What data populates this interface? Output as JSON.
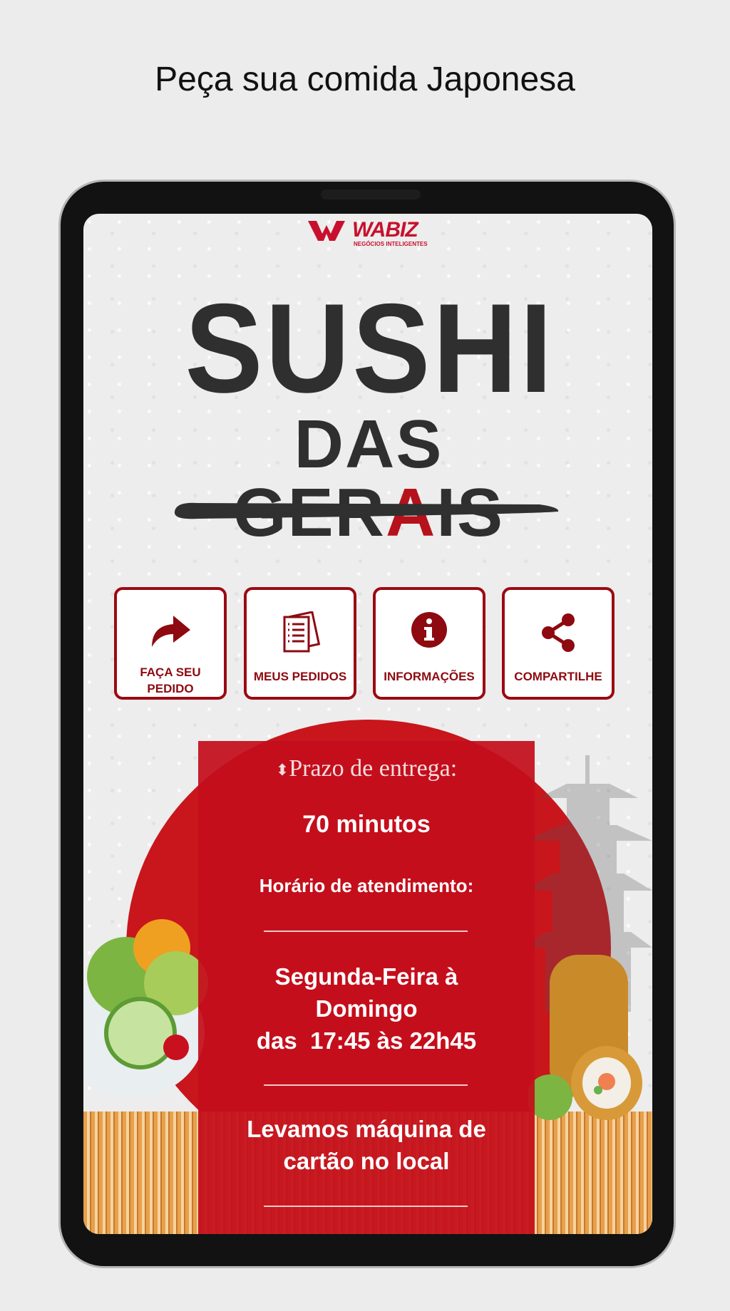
{
  "headline": "Peça sua comida Japonesa",
  "brand": {
    "name": "WABIZ",
    "tagline": "NEGÓCIOS INTELIGENTES"
  },
  "logo": {
    "line1": "SUSHI",
    "line2_part1": "DAS GER",
    "line2_red": "A",
    "line2_part2": "IS"
  },
  "buttons": [
    {
      "label_line1": "FAÇA SEU",
      "label_line2": "PEDIDO",
      "icon": "share-arrow-icon"
    },
    {
      "label": "MEUS PEDIDOS",
      "icon": "receipt-icon"
    },
    {
      "label": "INFORMAÇÕES",
      "icon": "info-icon"
    },
    {
      "label": "COMPARTILHE",
      "icon": "share-icon"
    }
  ],
  "info": {
    "delivery_label": "Prazo de entrega:",
    "delivery_time": "70 minutos",
    "hours_label": "Horário de atendimento:",
    "days_line1": "Segunda-Feira à",
    "days_line2": "Domingo",
    "days_line3": "das  17:45 às 22h45",
    "card_line1": "Levamos máquina de",
    "card_line2": "cartão no local"
  },
  "colors": {
    "accent": "#c8102e",
    "button_border": "#9b0a12",
    "panel": "#c40e1c"
  }
}
